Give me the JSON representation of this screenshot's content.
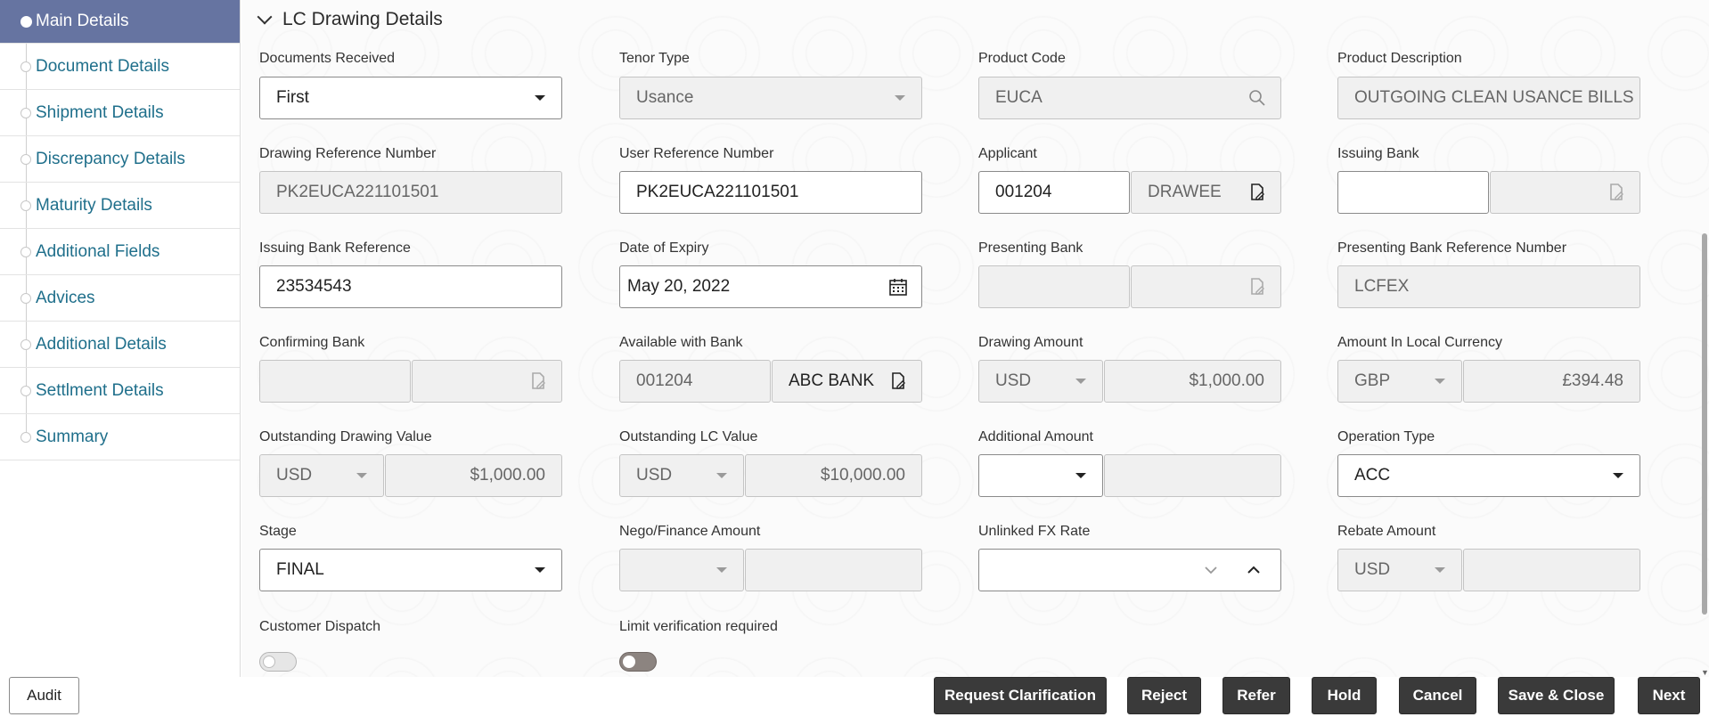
{
  "sidebar": {
    "items": [
      {
        "label": "Main Details",
        "active": true
      },
      {
        "label": "Document Details"
      },
      {
        "label": "Shipment Details"
      },
      {
        "label": "Discrepancy Details"
      },
      {
        "label": "Maturity Details"
      },
      {
        "label": "Additional Fields"
      },
      {
        "label": "Advices"
      },
      {
        "label": "Additional Details"
      },
      {
        "label": "Settlment Details"
      },
      {
        "label": "Summary"
      }
    ]
  },
  "section": {
    "title": "LC Drawing Details"
  },
  "fields": {
    "documents_received": {
      "label": "Documents Received",
      "value": "First"
    },
    "tenor_type": {
      "label": "Tenor Type",
      "value": "Usance"
    },
    "product_code": {
      "label": "Product Code",
      "value": "EUCA"
    },
    "product_description": {
      "label": "Product Description",
      "value": "OUTGOING CLEAN USANCE BILLS UNDER LC"
    },
    "drawing_reference_number": {
      "label": "Drawing Reference Number",
      "value": "PK2EUCA221101501"
    },
    "user_reference_number": {
      "label": "User Reference Number",
      "value": "PK2EUCA221101501"
    },
    "applicant": {
      "label": "Applicant",
      "id": "001204",
      "name": "DRAWEE"
    },
    "issuing_bank": {
      "label": "Issuing Bank",
      "id": "",
      "name": ""
    },
    "issuing_bank_reference": {
      "label": "Issuing Bank Reference",
      "value": "23534543"
    },
    "date_of_expiry": {
      "label": "Date of Expiry",
      "value": "May 20, 2022"
    },
    "presenting_bank": {
      "label": "Presenting Bank",
      "id": "",
      "name": ""
    },
    "presenting_bank_reference_number": {
      "label": "Presenting Bank Reference Number",
      "value": "LCFEX"
    },
    "confirming_bank": {
      "label": "Confirming Bank",
      "id": "",
      "name": ""
    },
    "available_with_bank": {
      "label": "Available with Bank",
      "id": "001204",
      "name": "ABC BANK"
    },
    "drawing_amount": {
      "label": "Drawing Amount",
      "currency": "USD",
      "amount": "$1,000.00"
    },
    "amount_in_local_currency": {
      "label": "Amount In Local Currency",
      "currency": "GBP",
      "amount": "£394.48"
    },
    "outstanding_drawing_value": {
      "label": "Outstanding Drawing Value",
      "currency": "USD",
      "amount": "$1,000.00"
    },
    "outstanding_lc_value": {
      "label": "Outstanding LC Value",
      "currency": "USD",
      "amount": "$10,000.00"
    },
    "additional_amount": {
      "label": "Additional Amount",
      "currency": "",
      "amount": ""
    },
    "operation_type": {
      "label": "Operation Type",
      "value": "ACC"
    },
    "stage": {
      "label": "Stage",
      "value": "FINAL"
    },
    "nego_finance_amount": {
      "label": "Nego/Finance Amount",
      "currency": "",
      "amount": ""
    },
    "unlinked_fx_rate": {
      "label": "Unlinked FX Rate",
      "value": ""
    },
    "rebate_amount": {
      "label": "Rebate Amount",
      "currency": "USD",
      "amount": ""
    },
    "customer_dispatch": {
      "label": "Customer Dispatch",
      "on": false
    },
    "limit_verification_required": {
      "label": "Limit verification required",
      "on": false
    }
  },
  "footer": {
    "audit": "Audit",
    "request_clarification": "Request Clarification",
    "reject": "Reject",
    "refer": "Refer",
    "hold": "Hold",
    "cancel": "Cancel",
    "save_close": "Save & Close",
    "next": "Next"
  },
  "colors": {
    "sidebar_active": "#6674a1",
    "link": "#1f6f8b",
    "button_dark": "#3a3a3a"
  }
}
